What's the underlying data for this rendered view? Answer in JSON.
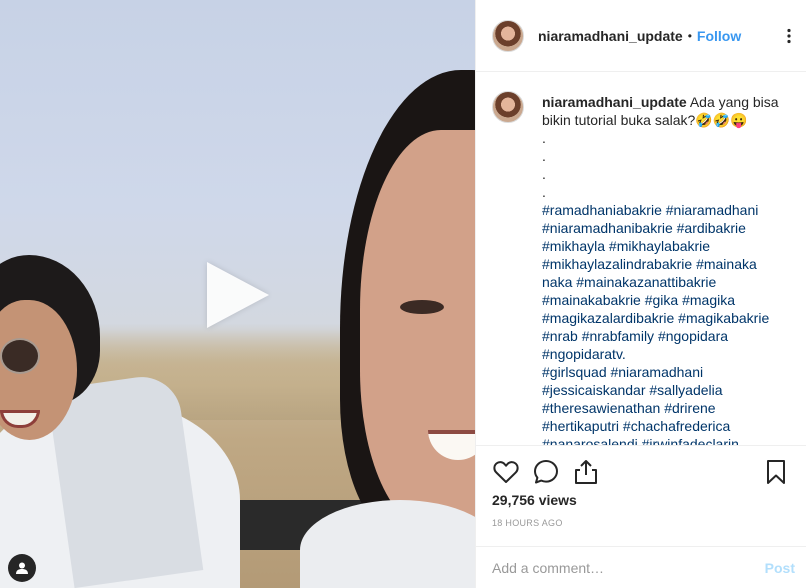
{
  "post": {
    "username": "niaramadhani_update",
    "separator": "•",
    "follow_label": "Follow"
  },
  "caption": {
    "username": "niaramadhani_update",
    "text": "Ada yang bisa bikin tutorial buka salak?🤣🤣😛",
    "dots": [
      ".",
      ".",
      ".",
      "."
    ],
    "hashtag_lines": [
      "#ramadhaniabakrie #niaramadhani",
      "#niaramadhanibakrie #ardibakrie",
      "#mikhayla #mikhaylabakrie",
      "#mikhaylazalindrabakrie #mainaka",
      "naka #mainakazanattibakrie",
      "#mainakabakrie #gika #magika",
      "#magikazalardibakrie #magikabakrie",
      "#nrab #nrabfamily #ngopidara",
      "#ngopidaratv.",
      "#girlsquad #niaramadhani",
      "#jessicaiskandar #sallyadelia",
      "#theresawienathan #drirene",
      "#hertikaputri #chachafrederica",
      "#nanarosalendi #irwinfadeclarin"
    ]
  },
  "stats": {
    "views": "29,756 views",
    "time_ago": "18 HOURS AGO"
  },
  "comment": {
    "placeholder": "Add a comment…",
    "post_label": "Post"
  },
  "icons": {
    "play": "play-icon",
    "more": "more-options-icon",
    "like": "heart-icon",
    "comment": "comment-icon",
    "share": "share-icon",
    "save": "bookmark-icon",
    "badge": "user-tag-icon"
  },
  "colors": {
    "link": "#3897f0",
    "hashtag": "#003569",
    "muted": "#999999",
    "post_disabled": "#b2dffc"
  }
}
